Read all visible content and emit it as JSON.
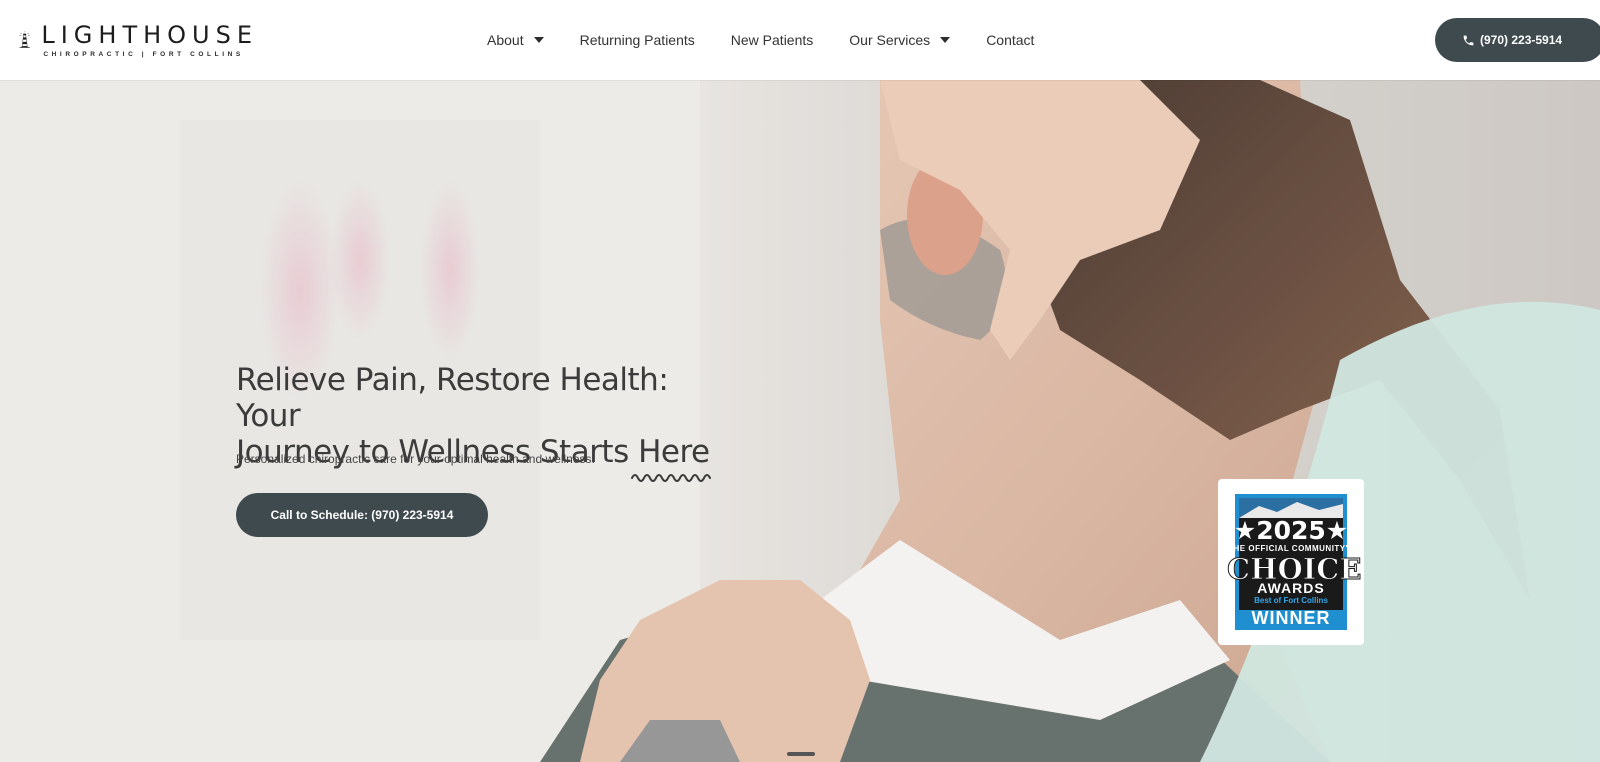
{
  "brand": {
    "name": "LIGHTHOUSE",
    "tagline": "CHIROPRACTIC | FORT COLLINS"
  },
  "nav": {
    "items": [
      {
        "label": "About",
        "has_dropdown": true
      },
      {
        "label": "Returning Patients",
        "has_dropdown": false
      },
      {
        "label": "New Patients",
        "has_dropdown": false
      },
      {
        "label": "Our Services",
        "has_dropdown": true
      },
      {
        "label": "Contact",
        "has_dropdown": false
      }
    ],
    "phone_label": "(970) 223-5914"
  },
  "hero": {
    "headline_line1": "Relieve Pain, Restore Health: Your",
    "headline_line2_start": "Journey to Wellness Starts ",
    "headline_emphasis": "Here",
    "subtext": "Personalized chiropractic care for your optimal health and wellness.",
    "cta_label": "Call to Schedule: (970) 223-5914"
  },
  "award": {
    "year": "★2025★",
    "line1": "THE OFFICIAL COMMUNITY'S",
    "choice": "CHOICE",
    "awards": "AWARDS",
    "best_of": "Best of Fort Collins",
    "winner": "WINNER"
  },
  "colors": {
    "button_bg": "#3f4a4e",
    "button_text": "#ffffff",
    "heading_text": "#3b3b3b",
    "badge_blue": "#1f8fd0"
  },
  "icons": {
    "phone": "phone-icon",
    "logo": "lighthouse-logo-icon",
    "caret": "caret-down-icon"
  }
}
